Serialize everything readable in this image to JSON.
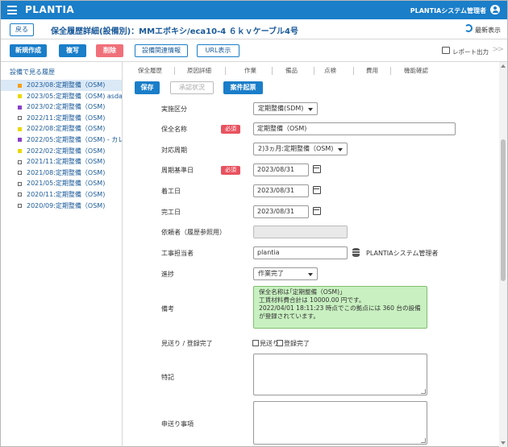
{
  "app": {
    "brand": "PLANTIA",
    "user": "PLANTIAシステム管理者"
  },
  "titlebar": {
    "back": "戻る",
    "title": "保全履歴詳細(設備別)：MMエボキシ/eca10-4 ６ｋｖケーブル4号",
    "refresh": "最新表示"
  },
  "toolbar": {
    "new": "新規作成",
    "copy": "複写",
    "delete": "削除",
    "equipment_info": "設備関連情報",
    "url": "URL表示",
    "report": "レポート出力"
  },
  "left": {
    "title": "設備で見る履歴",
    "items": [
      {
        "label": "2023/08:定期整備（OSM)",
        "color": "#f5a11a",
        "hollow": false,
        "active": true
      },
      {
        "label": "2023/05:定期整備（OSM) asdasd",
        "color": "#e8d800",
        "hollow": false,
        "active": false
      },
      {
        "label": "2023/02:定期整備（OSM)",
        "color": "#8a3fc7",
        "hollow": false,
        "active": false
      },
      {
        "label": "2022/11:定期整備（OSM)",
        "color": "#ffffff",
        "hollow": true,
        "active": false
      },
      {
        "label": "2022/08:定期整備（OSM)",
        "color": "#e8d800",
        "hollow": false,
        "active": false
      },
      {
        "label": "2022/05:定期整備（OSM) - カレンダ",
        "color": "#8a3fc7",
        "hollow": false,
        "active": false
      },
      {
        "label": "2022/02:定期整備（OSM)",
        "color": "#e8d800",
        "hollow": false,
        "active": false
      },
      {
        "label": "2021/11:定期整備（OSM)",
        "color": "#ffffff",
        "hollow": true,
        "active": false
      },
      {
        "label": "2021/08:定期整備（OSM)",
        "color": "#ffffff",
        "hollow": true,
        "active": false
      },
      {
        "label": "2021/05:定期整備（OSM)",
        "color": "#ffffff",
        "hollow": true,
        "active": false
      },
      {
        "label": "2020/11:定期整備（OSM)",
        "color": "#ffffff",
        "hollow": true,
        "active": false
      },
      {
        "label": "2020/09:定期整備（OSM)",
        "color": "#ffffff",
        "hollow": true,
        "active": false
      }
    ]
  },
  "tabs": [
    "保全履歴",
    "原因詳細",
    "作業",
    "備品",
    "点検",
    "費用",
    "機能確認"
  ],
  "actions": {
    "save": "保存",
    "approval": "承認状況",
    "case": "案件起票"
  },
  "form": {
    "category": {
      "label": "実施区分",
      "value": "定期整備(SDM)"
    },
    "name": {
      "label": "保全名称",
      "required": "必須",
      "value": "定期整備（OSM)"
    },
    "cycle": {
      "label": "対応周期",
      "value": "2)3ヵ月:定期整備（OSM)"
    },
    "base_date": {
      "label": "周期基準日",
      "required": "必須",
      "value": "2023/08/31"
    },
    "start_date": {
      "label": "着工日",
      "value": "2023/08/31"
    },
    "end_date": {
      "label": "完工日",
      "value": "2023/08/31"
    },
    "requester": {
      "label": "依頼者（履歴参照用）",
      "value": ""
    },
    "person": {
      "label": "工事担当者",
      "value": "plantia",
      "display": "PLANTIAシステム管理者"
    },
    "progress": {
      "label": "進捗",
      "value": "作業完了"
    },
    "remarks": {
      "label": "備考",
      "lines": [
        "保全名称は｢定期整備（OSM)」",
        "工賃材料費合計は 10000.00 円です。",
        "2022/04/01 18:11:23 時点でこの拠点には 360 台の設備",
        "が登録されています。"
      ]
    },
    "status": {
      "label": "見送り / 登録完了",
      "skip": "見送り",
      "done": "登録完了"
    },
    "notes": {
      "label": "特記"
    },
    "handover": {
      "label": "申送り事項"
    }
  }
}
